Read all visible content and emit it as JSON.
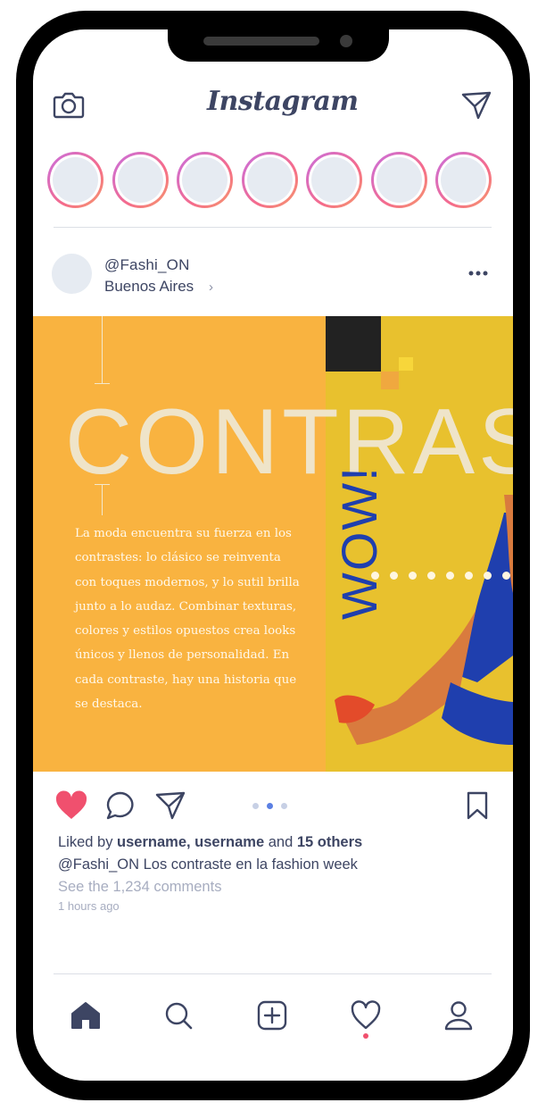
{
  "app": {
    "title": "Instagram"
  },
  "post": {
    "username": "@Fashi_ON",
    "location": "Buenos Aires",
    "image": {
      "title": "CONTRAS",
      "body": "La moda encuentra su fuerza en los contrastes: lo clásico se reinventa con toques modernos, y lo sutil brilla junto a lo audaz. Combinar texturas, colores y estilos opuestos crea looks únicos y llenos de personalidad. En cada contraste, hay una historia que se destaca.",
      "exclaim": "WOW!",
      "carousel_index": 2,
      "carousel_count": 3
    },
    "likes": {
      "prefix": "Liked by ",
      "users": "username, username",
      "conjunction": " and ",
      "others": "15 others"
    },
    "caption": {
      "username": "@Fashi_ON",
      "text": " Los contraste en la fashion week"
    },
    "comments_link": "See the 1,234 comments",
    "timestamp": "1 hours ago",
    "liked": true
  },
  "stories_count": 7,
  "icons": {
    "camera": "camera-icon",
    "send": "send-icon",
    "heart": "heart-icon",
    "comment": "comment-icon",
    "share": "share-icon",
    "bookmark": "bookmark-icon",
    "home": "home-icon",
    "search": "search-icon",
    "add": "add-icon",
    "activity": "activity-icon",
    "profile": "profile-icon",
    "more": "more-icon"
  },
  "colors": {
    "accent": "#f0506e",
    "text": "#3d4563",
    "orange": "#f9b340",
    "yellow": "#e8c12e",
    "blue": "#1f3fae"
  }
}
